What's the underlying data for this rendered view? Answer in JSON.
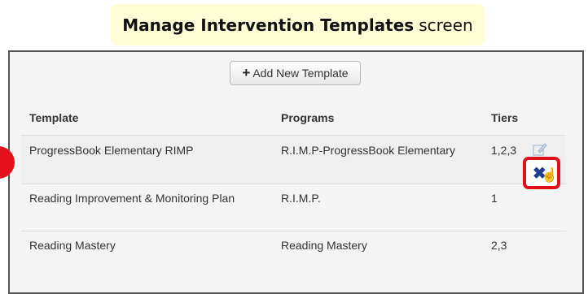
{
  "caption": {
    "bold": "Manage Intervention Templates",
    "rest": "screen"
  },
  "toolbar": {
    "add_label": "Add New Template"
  },
  "table": {
    "headers": {
      "template": "Template",
      "programs": "Programs",
      "tiers": "Tiers"
    },
    "rows": [
      {
        "template": "ProgressBook Elementary RIMP",
        "programs": "R.I.M.P-ProgressBook Elementary",
        "tiers": "1,2,3"
      },
      {
        "template": "Reading Improvement & Monitoring Plan",
        "programs": "R.I.M.P.",
        "tiers": "1"
      },
      {
        "template": "Reading Mastery",
        "programs": "Reading Mastery",
        "tiers": "2,3"
      }
    ]
  },
  "colors": {
    "highlight": "#e0101a",
    "caption_bg": "#fefdd6",
    "delete_icon": "#1d3f8f"
  }
}
